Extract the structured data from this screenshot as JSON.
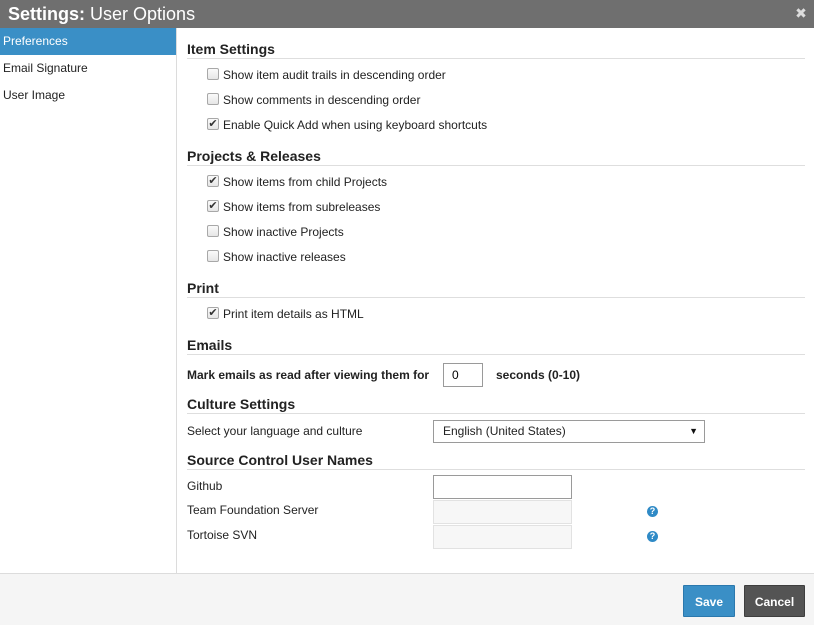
{
  "dialog": {
    "title_strong": "Settings:",
    "title_rest": "User Options",
    "close_glyph": "✖"
  },
  "sidebar": {
    "items": [
      {
        "label": "Preferences",
        "active": true
      },
      {
        "label": "Email Signature",
        "active": false
      },
      {
        "label": "User Image",
        "active": false
      }
    ]
  },
  "sections": {
    "item_settings": {
      "title": "Item Settings",
      "options": [
        {
          "label": "Show item audit trails in descending order",
          "checked": false
        },
        {
          "label": "Show comments in descending order",
          "checked": false
        },
        {
          "label": "Enable Quick Add when using keyboard shortcuts",
          "checked": true
        }
      ]
    },
    "projects_releases": {
      "title": "Projects & Releases",
      "options": [
        {
          "label": "Show items from child Projects",
          "checked": true
        },
        {
          "label": "Show items from subreleases",
          "checked": true
        },
        {
          "label": "Show inactive Projects",
          "checked": false
        },
        {
          "label": "Show inactive releases",
          "checked": false
        }
      ]
    },
    "print": {
      "title": "Print",
      "options": [
        {
          "label": "Print item details as HTML",
          "checked": true
        }
      ]
    },
    "emails": {
      "title": "Emails",
      "label_before": "Mark emails as read after viewing them for",
      "value": "0",
      "label_after": "seconds (0-10)"
    },
    "culture": {
      "title": "Culture Settings",
      "label": "Select your language and culture",
      "selected": "English (United States)"
    },
    "source_control": {
      "title": "Source Control User Names",
      "rows": [
        {
          "label": "Github",
          "value": "",
          "disabled": false,
          "help": false
        },
        {
          "label": "Team Foundation Server",
          "value": "",
          "disabled": true,
          "help": true
        },
        {
          "label": "Tortoise SVN",
          "value": "",
          "disabled": true,
          "help": true
        }
      ]
    }
  },
  "footer": {
    "save_label": "Save",
    "cancel_label": "Cancel"
  },
  "colors": {
    "accent": "#3a8fc6",
    "titlebar": "#6f6f6f",
    "cancel": "#545454"
  }
}
